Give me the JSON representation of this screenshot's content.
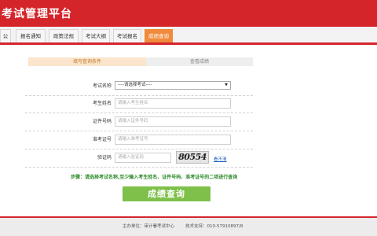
{
  "header": {
    "title": "考试管理平台"
  },
  "nav": {
    "tabs": [
      "公告",
      "报名通知",
      "政策法规",
      "考试大纲",
      "考试报名",
      "成绩查询"
    ]
  },
  "steps": {
    "step1": "填写查询条件",
    "step2": "查看成绩"
  },
  "form": {
    "exam_name_label": "考试名称",
    "exam_name_value": "----请选择考试----",
    "name_label": "考生姓名",
    "name_placeholder": "请输入考生姓名",
    "id_label": "证件号码",
    "id_placeholder": "请输入证件号码",
    "ticket_label": "准考证号",
    "ticket_placeholder": "请输入准考证号",
    "captcha_label": "验证码",
    "captcha_placeholder": "请输入验证码",
    "captcha_text": "80554",
    "refresh_label": "看不清",
    "tip": "步骤：请选择考试名称,至少输入考生姓名、证件号码、准考证号的二项进行查询",
    "submit_label": "成绩查询"
  },
  "footer": {
    "sponsor": "主办单位：审计署考试中心",
    "support": "技术支持：010-57910897/8"
  },
  "colors": {
    "brand_red": "#d4252a",
    "active_tab": "#f08a3c",
    "button_green": "#7ec04a"
  }
}
